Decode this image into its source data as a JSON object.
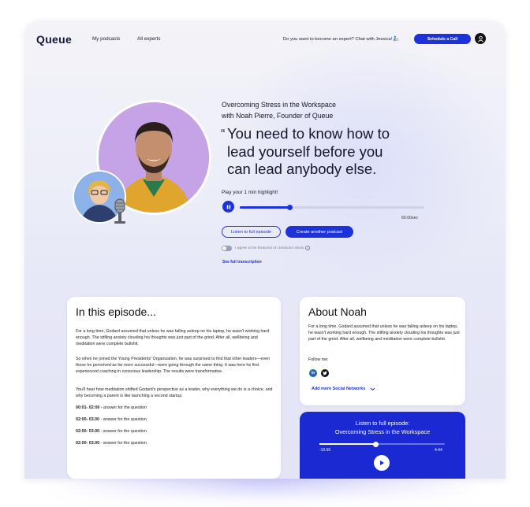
{
  "header": {
    "logo": "Queue",
    "nav": [
      "My podcasts",
      "All experts"
    ],
    "chat_prompt": "Do you want to become an expert? Chat with Jessica!",
    "chat_emoji": "🧞",
    "schedule_button": "Schedule a Call",
    "user_icon": "user-icon"
  },
  "hero": {
    "episode_title": "Overcoming Stress in the Workspace",
    "episode_subtitle": "with Noah Pierre, Founder of Queue",
    "quote_mark": "“",
    "quote_lines": [
      "You need to know how to",
      "lead yourself before you",
      "can lead anybody else."
    ],
    "highlight_label": "Play your 1 min highlight!",
    "highlight_progress": 0.27,
    "highlight_time": "60.00sec",
    "listen_button": "Listen to full episode",
    "create_button": "Create another podcast",
    "agree_label": "I agree to be featured on Jessica's show",
    "agree_checked": false,
    "transcript_link": "See full transcription"
  },
  "episode": {
    "title": "In this episode...",
    "paragraphs": [
      "For a long time, Godard assumed that unless he was falling asleep on his laptop, he wasn't working hard enough. The stifling anxiety clouding his thoughts was just part of the grind. After all, wellbeing and meditation were complete bullshit.",
      "So when he joined the Young Presidents' Organization, he was surprised to find that other leaders—even those he perceived as far more successful—were going through the same thing. It was here he first experienced coaching in conscious leadership. The results were transformative.",
      "You'll hear how meditation shifted Godard's perspective as a leader, why everything we do is a choice, and why becoming a parent is like launching a second startup."
    ],
    "timeline": [
      {
        "time": "00:01- 02:00",
        "text": " - answer for the question"
      },
      {
        "time": "02:00- 03.00",
        "text": " - answer for the question"
      },
      {
        "time": "02:00- 03.00",
        "text": " - answer for the question"
      },
      {
        "time": "02:00- 03.00",
        "text": " - answer for the question"
      }
    ]
  },
  "about": {
    "title": "About Noah",
    "text": "For a long time, Godard assumed that unless he was falling asleep on his laptop, he wasn't working hard enough. The stifling anxiety clouding his thoughts was just part of the grind. After all, wellbeing and meditation were complete bullshit.",
    "follow_label": "Follow me:",
    "linkedin_glyph": "in",
    "socials": [
      "linkedin-icon",
      "twitter-icon"
    ],
    "more_networks": "Add more Social Networks"
  },
  "player": {
    "label": "Listen to full episode:",
    "title": "Overcoming Stress in the Workspace",
    "elapsed": "-10.55",
    "total": "4:44",
    "progress": 0.45
  },
  "colors": {
    "accent": "#1d32d8",
    "player_bg": "#1a29d1",
    "text": "#16162c"
  }
}
